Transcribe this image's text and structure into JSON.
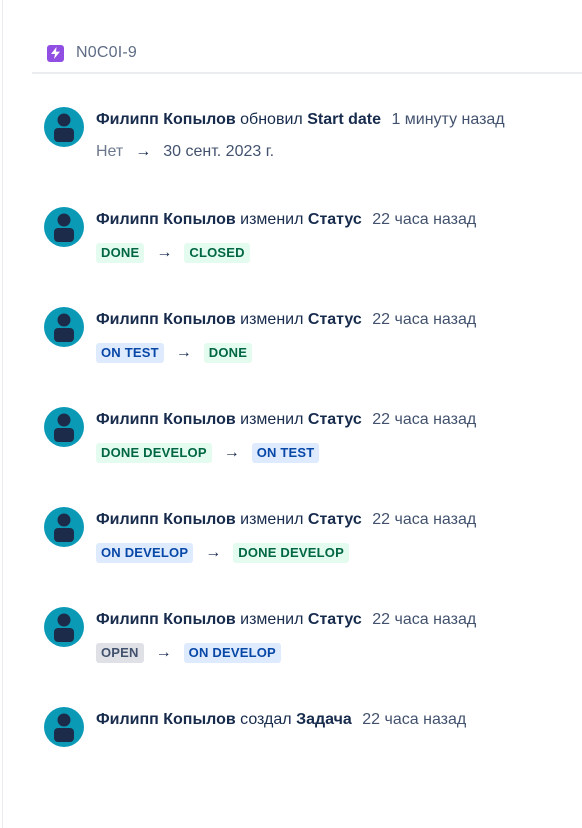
{
  "header": {
    "issue_key": "N0C0I-9",
    "issue_type_icon": "lightning-bolt-icon",
    "icon_color": "#904ee2"
  },
  "entries": [
    {
      "author": "Филипп Копылов",
      "action": "обновил",
      "field": "Start date",
      "time": "1 минуту назад",
      "old": "Нет",
      "new": "30 сент. 2023 г."
    },
    {
      "author": "Филипп Копылов",
      "action": "изменил",
      "field": "Статус",
      "time": "22 часа назад",
      "old": "DONE",
      "new": "CLOSED"
    },
    {
      "author": "Филипп Копылов",
      "action": "изменил",
      "field": "Статус",
      "time": "22 часа назад",
      "old": "ON TEST",
      "new": "DONE"
    },
    {
      "author": "Филипп Копылов",
      "action": "изменил",
      "field": "Статус",
      "time": "22 часа назад",
      "old": "DONE DEVELOP",
      "new": "ON TEST"
    },
    {
      "author": "Филипп Копылов",
      "action": "изменил",
      "field": "Статус",
      "time": "22 часа назад",
      "old": "ON DEVELOP",
      "new": "DONE DEVELOP"
    },
    {
      "author": "Филипп Копылов",
      "action": "изменил",
      "field": "Статус",
      "time": "22 часа назад",
      "old": "OPEN",
      "new": "ON DEVELOP"
    },
    {
      "author": "Филипп Копылов",
      "action": "создал",
      "field": "Задача",
      "time": "22 часа назад"
    }
  ],
  "arrow": "→",
  "colors": {
    "avatar_bg": "#0b9ab6",
    "avatar_figure": "#1d2b4a",
    "lozenge_green_bg": "#e3fcef",
    "lozenge_green_text": "#006644",
    "lozenge_blue_bg": "#deebff",
    "lozenge_blue_text": "#0747a6",
    "lozenge_gray_bg": "#dfe1e6",
    "lozenge_gray_text": "#42526e"
  }
}
